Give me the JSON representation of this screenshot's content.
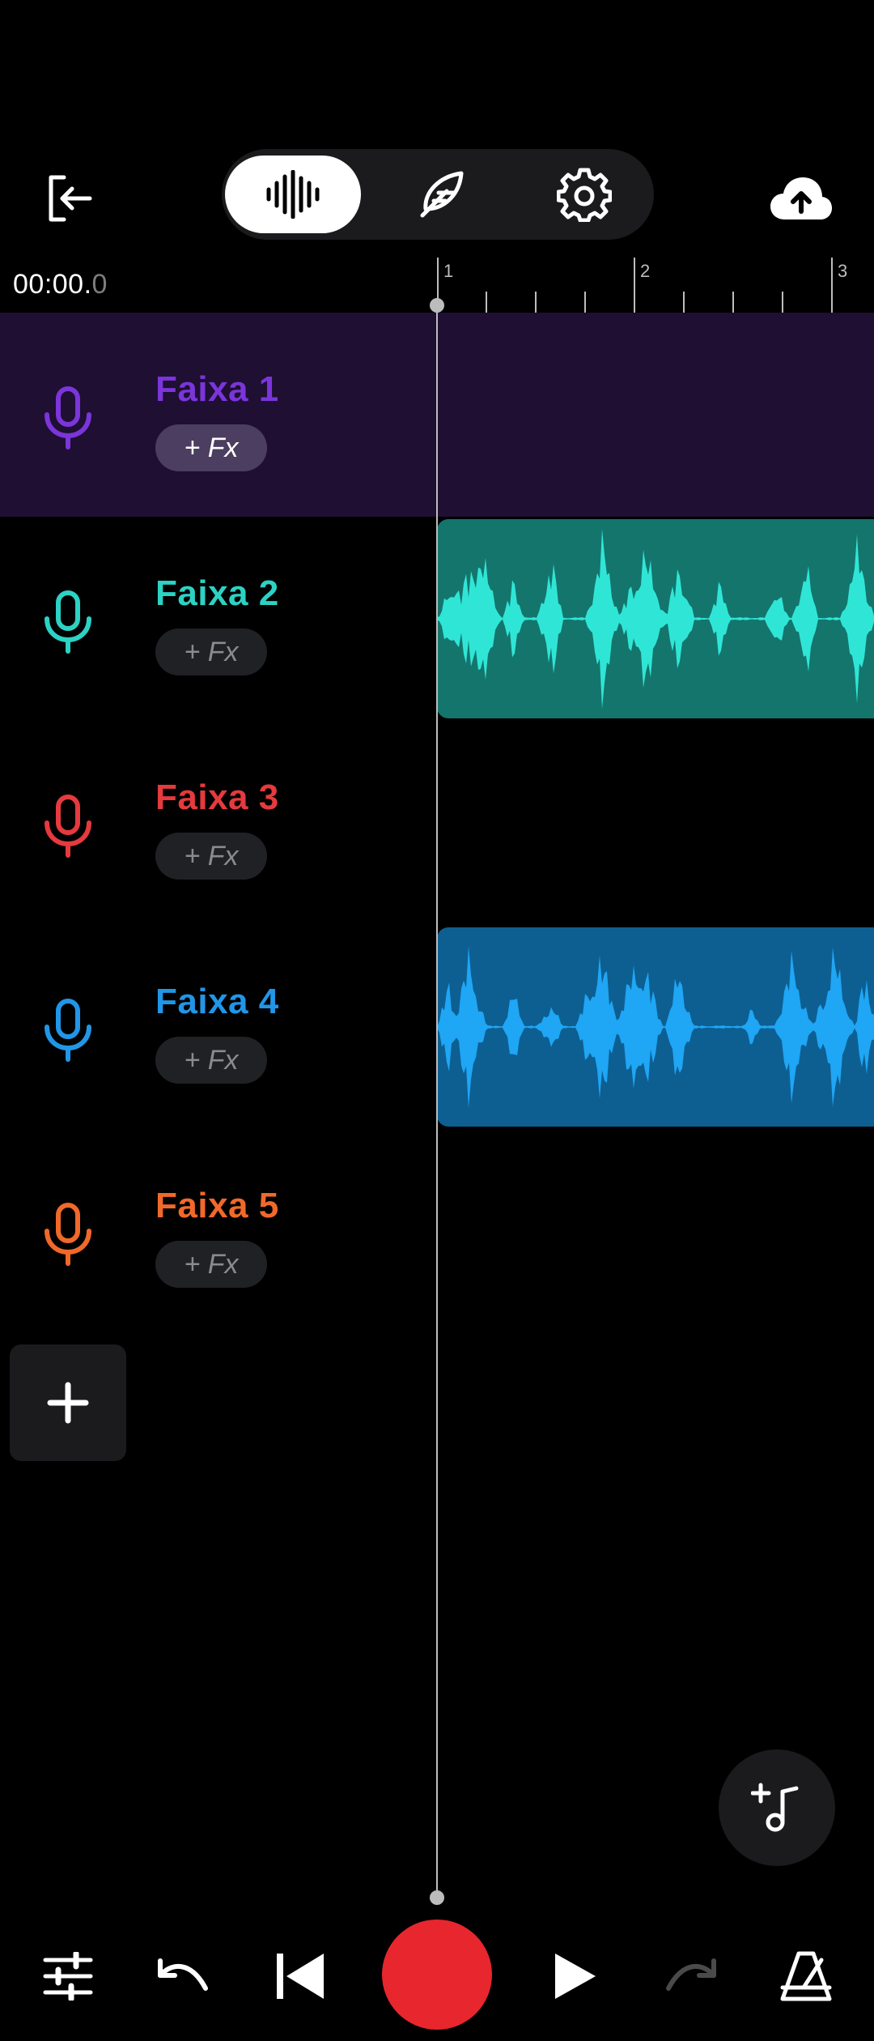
{
  "header": {
    "exit_icon": "exit-icon",
    "upload_icon": "cloud-upload-icon",
    "modes": [
      {
        "id": "waveform",
        "icon": "waveform-icon",
        "active": true
      },
      {
        "id": "lyrics",
        "icon": "feather-icon",
        "active": false
      },
      {
        "id": "settings",
        "icon": "gear-icon",
        "active": false
      }
    ]
  },
  "time": {
    "main": "00:00.",
    "fraction": "0"
  },
  "ruler": {
    "bars": [
      "1",
      "2",
      "3"
    ]
  },
  "tracks": [
    {
      "name": "Faixa 1",
      "fx_label": "+ Fx",
      "color": "#7b35d9",
      "selected": true,
      "has_clip": false
    },
    {
      "name": "Faixa 2",
      "fx_label": "+ Fx",
      "color": "#2cd2c4",
      "selected": false,
      "has_clip": true,
      "clip_bg": "#14756d",
      "wave": "#2fe6d6"
    },
    {
      "name": "Faixa 3",
      "fx_label": "+ Fx",
      "color": "#e53a3e",
      "selected": false,
      "has_clip": false
    },
    {
      "name": "Faixa 4",
      "fx_label": "+ Fx",
      "color": "#2196e8",
      "selected": false,
      "has_clip": true,
      "clip_bg": "#0d5f92",
      "wave": "#1fa6f5"
    },
    {
      "name": "Faixa 5",
      "fx_label": "+ Fx",
      "color": "#f0692a",
      "selected": false,
      "has_clip": false
    }
  ],
  "actions": {
    "add_track_icon": "plus-icon",
    "add_note_icon": "add-music-note-icon"
  },
  "transport": {
    "icons": [
      "mixer-sliders-icon",
      "undo-icon",
      "skip-back-icon",
      "record-icon",
      "play-icon",
      "redo-icon",
      "metronome-icon"
    ],
    "record_color": "#e8262d",
    "redo_enabled": false
  }
}
